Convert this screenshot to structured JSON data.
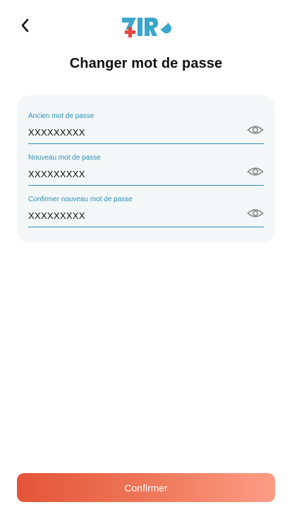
{
  "header": {
    "back_icon": "chevron-left-icon",
    "logo_icon": "app-logo"
  },
  "title": "Changer mot de passe",
  "fields": [
    {
      "label": "Ancien mot de passe",
      "value": "XXXXXXXXX",
      "icon": "eye-icon"
    },
    {
      "label": "Nouveau mot de passe",
      "value": "XXXXXXXXX",
      "icon": "eye-icon"
    },
    {
      "label": "Confirmer nouveau mot de passe",
      "value": "XXXXXXXXX",
      "icon": "eye-icon"
    }
  ],
  "confirm_label": "Confirmer",
  "colors": {
    "accent_blue": "#2a8fb8",
    "logo_blue": "#3aa6c9",
    "logo_red": "#e8453c",
    "button_gradient_start": "#e45438",
    "button_gradient_end": "#fd9c85",
    "card_background": "#f3f7f7"
  }
}
